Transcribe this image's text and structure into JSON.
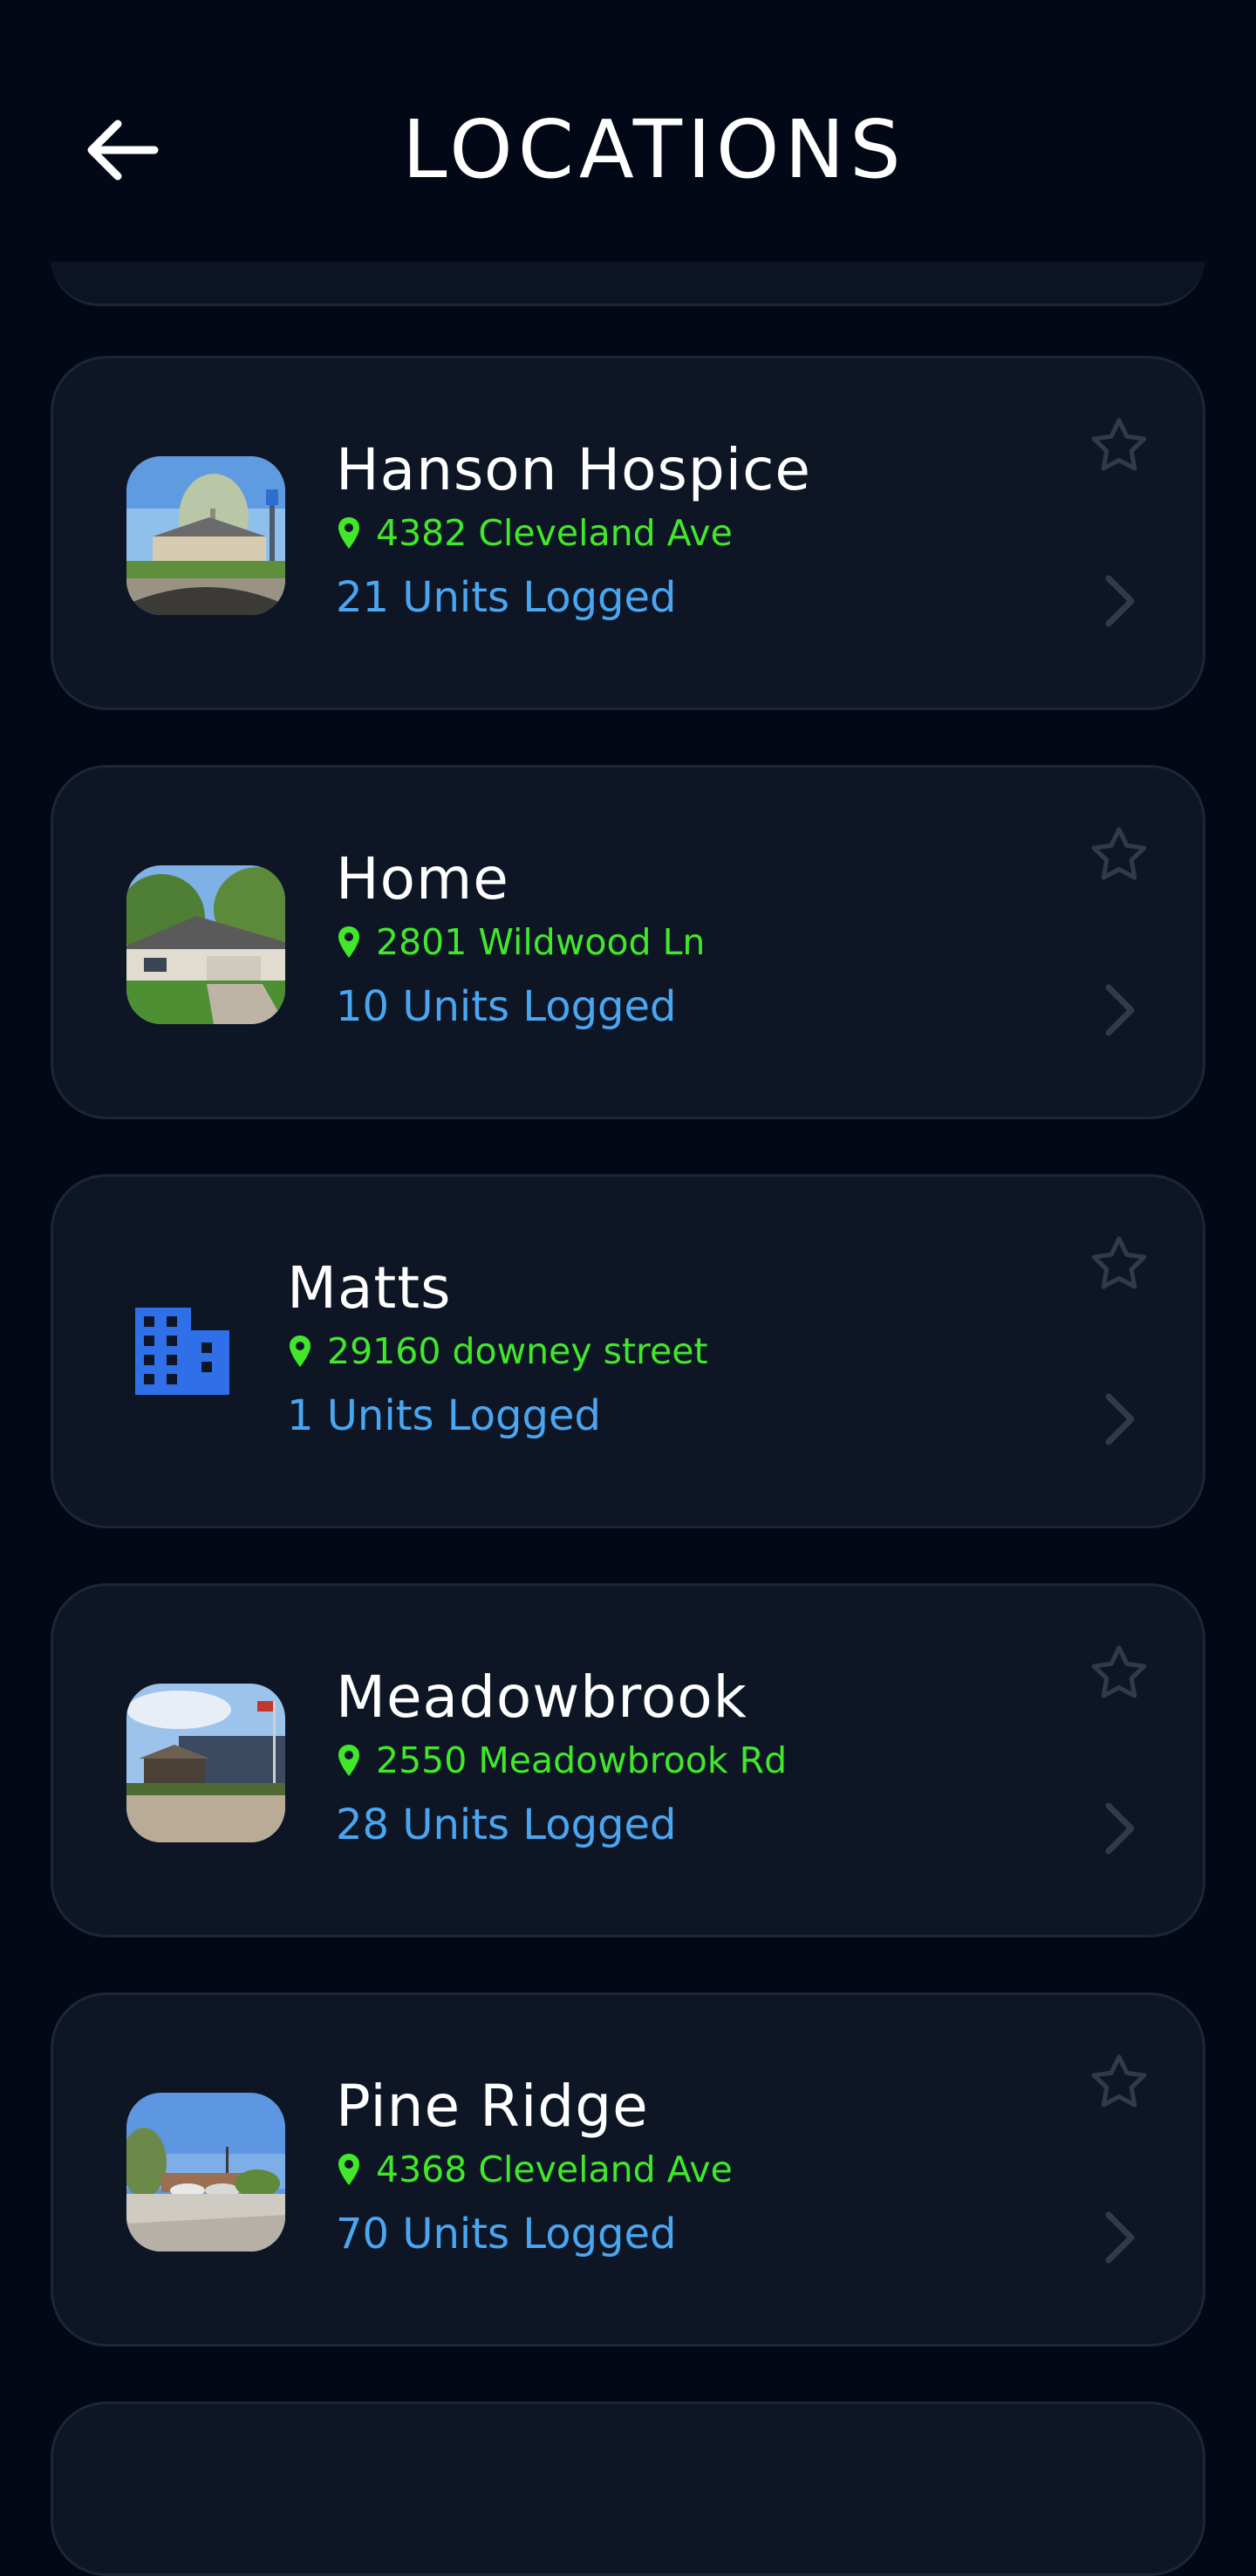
{
  "header": {
    "title": "LOCATIONS",
    "back_icon": "arrow-left-icon"
  },
  "colors": {
    "background": "#030816",
    "card": "#0e1626",
    "address_green": "#41e82a",
    "units_blue": "#4aa6f0",
    "muted_icon": "#2f3a4c",
    "building_blue": "#2f6fe8"
  },
  "locations": [
    {
      "name": "Hanson Hospice",
      "address": "4382 Cleveland Ave",
      "units": "21 Units Logged",
      "thumbnail": "photo",
      "favorite": false
    },
    {
      "name": "Home",
      "address": "2801 Wildwood Ln",
      "units": "10 Units Logged",
      "thumbnail": "photo",
      "favorite": false
    },
    {
      "name": "Matts",
      "address": "29160 downey street",
      "units": "1 Units Logged",
      "thumbnail": "building-icon",
      "favorite": false
    },
    {
      "name": "Meadowbrook",
      "address": "2550 Meadowbrook Rd",
      "units": "28 Units Logged",
      "thumbnail": "photo",
      "favorite": false
    },
    {
      "name": "Pine Ridge",
      "address": "4368 Cleveland Ave",
      "units": "70 Units Logged",
      "thumbnail": "photo",
      "favorite": false
    }
  ]
}
